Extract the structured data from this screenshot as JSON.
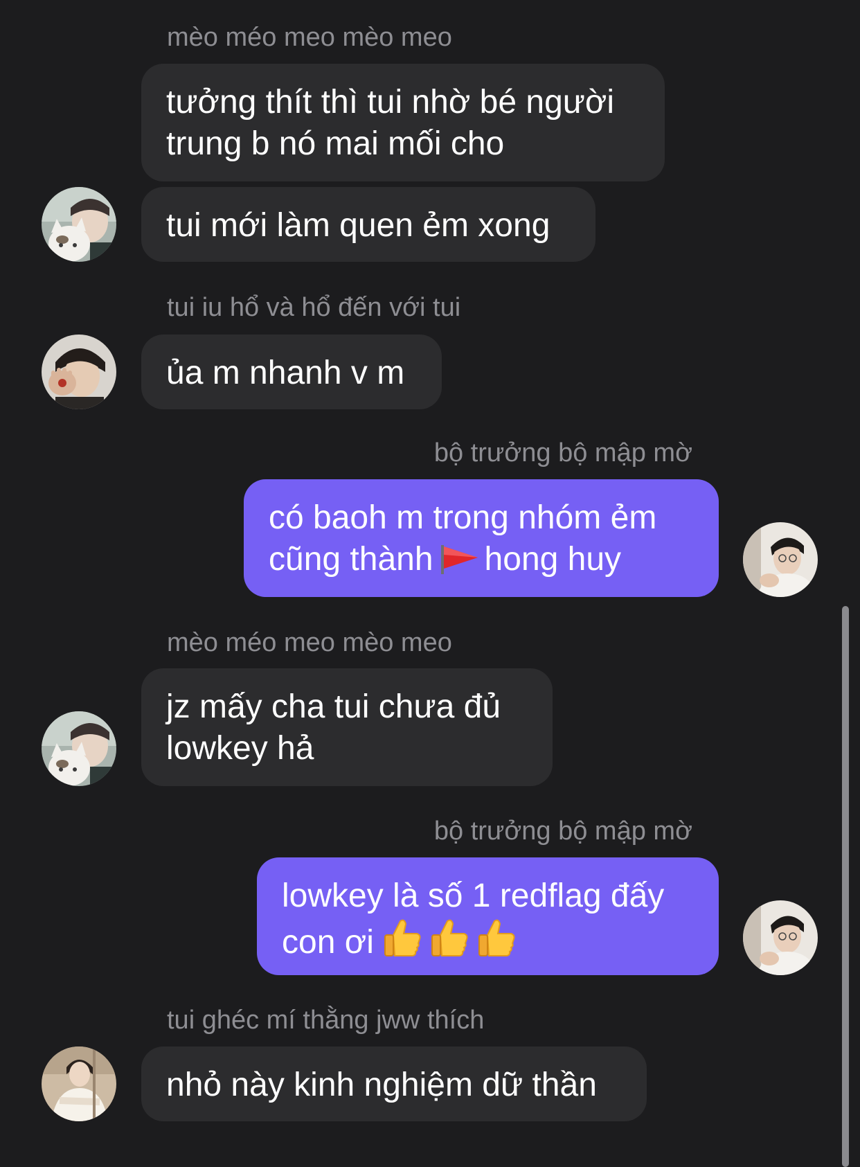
{
  "chat": {
    "senders": {
      "meo": "mèo méo meo mèo meo",
      "ho": "tui iu hổ và hổ đến với tui",
      "self": "bộ trưởng bộ mập mờ",
      "ghec": "tui ghéc mí thằng jww thích"
    },
    "messages": {
      "m1": "tưởng thít thì tui nhờ bé người trung b nó mai mối cho",
      "m2": "tui mới làm quen ẻm xong",
      "m3": "ủa m nhanh v m",
      "m4_part1": "có baoh m trong nhóm ẻm cũng thành",
      "m4_part2": "hong huy",
      "m5": "jz mấy cha tui chưa đủ lowkey hả",
      "m6": "lowkey là số 1 redflag đấy con ơi",
      "m7": "nhỏ này kinh nghiệm dữ thần"
    }
  },
  "colors": {
    "background": "#1c1c1e",
    "incoming_bubble": "#2c2c2e",
    "outgoing_bubble": "#7660f4",
    "sender_text": "#8e8e93",
    "message_text": "#ffffff"
  },
  "icons": {
    "flag": "red-triangular-flag-icon",
    "thumb": "thumbs-up-icon",
    "thumb_count": 3
  }
}
